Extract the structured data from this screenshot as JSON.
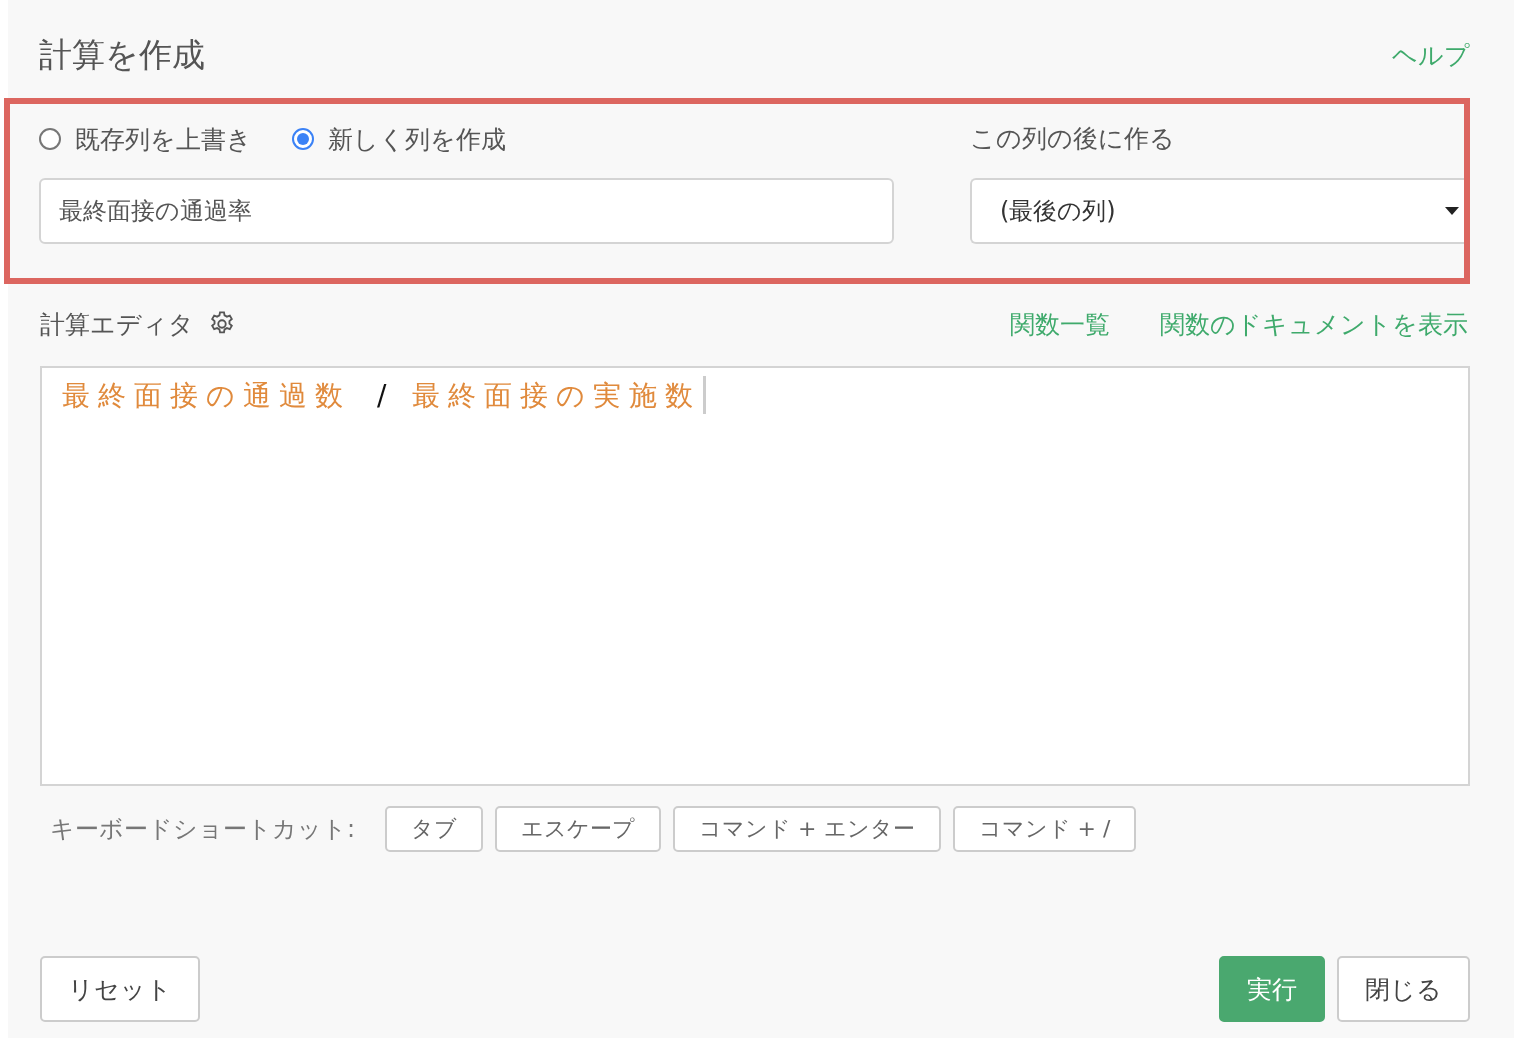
{
  "dialog": {
    "title": "計算を作成",
    "help_link": "ヘルプ"
  },
  "mode_options": [
    {
      "label": "既存列を上書き",
      "selected": false
    },
    {
      "label": "新しく列を作成",
      "selected": true
    }
  ],
  "column_name": {
    "value": "最終面接の通過率"
  },
  "position": {
    "label": "この列の後に作る",
    "value": "(最後の列)"
  },
  "editor": {
    "label": "計算エディタ",
    "links": [
      "関数一覧",
      "関数のドキュメントを表示"
    ],
    "tokens": [
      {
        "kind": "column",
        "text": "最終面接の通過数"
      },
      {
        "kind": "operator",
        "text": "/"
      },
      {
        "kind": "column",
        "text": "最終面接の実施数"
      }
    ]
  },
  "shortcuts": {
    "label": "キーボードショートカット:",
    "keys": [
      "タブ",
      "エスケープ",
      "コマンド + エンター",
      "コマンド + /"
    ]
  },
  "buttons": {
    "reset": "リセット",
    "run": "実行",
    "close": "閉じる"
  }
}
